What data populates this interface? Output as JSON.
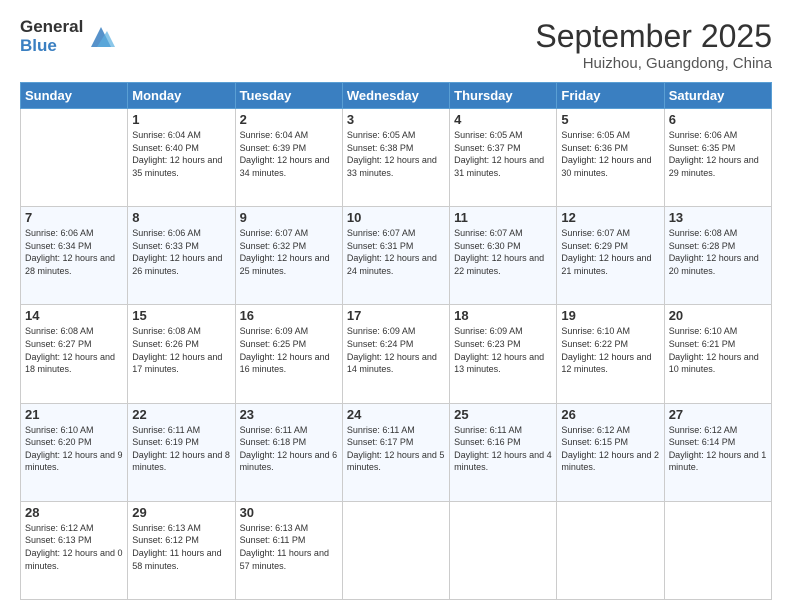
{
  "logo": {
    "general": "General",
    "blue": "Blue"
  },
  "header": {
    "month": "September 2025",
    "location": "Huizhou, Guangdong, China"
  },
  "weekdays": [
    "Sunday",
    "Monday",
    "Tuesday",
    "Wednesday",
    "Thursday",
    "Friday",
    "Saturday"
  ],
  "weeks": [
    [
      {
        "day": "",
        "sunrise": "",
        "sunset": "",
        "daylight": ""
      },
      {
        "day": "1",
        "sunrise": "Sunrise: 6:04 AM",
        "sunset": "Sunset: 6:40 PM",
        "daylight": "Daylight: 12 hours and 35 minutes."
      },
      {
        "day": "2",
        "sunrise": "Sunrise: 6:04 AM",
        "sunset": "Sunset: 6:39 PM",
        "daylight": "Daylight: 12 hours and 34 minutes."
      },
      {
        "day": "3",
        "sunrise": "Sunrise: 6:05 AM",
        "sunset": "Sunset: 6:38 PM",
        "daylight": "Daylight: 12 hours and 33 minutes."
      },
      {
        "day": "4",
        "sunrise": "Sunrise: 6:05 AM",
        "sunset": "Sunset: 6:37 PM",
        "daylight": "Daylight: 12 hours and 31 minutes."
      },
      {
        "day": "5",
        "sunrise": "Sunrise: 6:05 AM",
        "sunset": "Sunset: 6:36 PM",
        "daylight": "Daylight: 12 hours and 30 minutes."
      },
      {
        "day": "6",
        "sunrise": "Sunrise: 6:06 AM",
        "sunset": "Sunset: 6:35 PM",
        "daylight": "Daylight: 12 hours and 29 minutes."
      }
    ],
    [
      {
        "day": "7",
        "sunrise": "Sunrise: 6:06 AM",
        "sunset": "Sunset: 6:34 PM",
        "daylight": "Daylight: 12 hours and 28 minutes."
      },
      {
        "day": "8",
        "sunrise": "Sunrise: 6:06 AM",
        "sunset": "Sunset: 6:33 PM",
        "daylight": "Daylight: 12 hours and 26 minutes."
      },
      {
        "day": "9",
        "sunrise": "Sunrise: 6:07 AM",
        "sunset": "Sunset: 6:32 PM",
        "daylight": "Daylight: 12 hours and 25 minutes."
      },
      {
        "day": "10",
        "sunrise": "Sunrise: 6:07 AM",
        "sunset": "Sunset: 6:31 PM",
        "daylight": "Daylight: 12 hours and 24 minutes."
      },
      {
        "day": "11",
        "sunrise": "Sunrise: 6:07 AM",
        "sunset": "Sunset: 6:30 PM",
        "daylight": "Daylight: 12 hours and 22 minutes."
      },
      {
        "day": "12",
        "sunrise": "Sunrise: 6:07 AM",
        "sunset": "Sunset: 6:29 PM",
        "daylight": "Daylight: 12 hours and 21 minutes."
      },
      {
        "day": "13",
        "sunrise": "Sunrise: 6:08 AM",
        "sunset": "Sunset: 6:28 PM",
        "daylight": "Daylight: 12 hours and 20 minutes."
      }
    ],
    [
      {
        "day": "14",
        "sunrise": "Sunrise: 6:08 AM",
        "sunset": "Sunset: 6:27 PM",
        "daylight": "Daylight: 12 hours and 18 minutes."
      },
      {
        "day": "15",
        "sunrise": "Sunrise: 6:08 AM",
        "sunset": "Sunset: 6:26 PM",
        "daylight": "Daylight: 12 hours and 17 minutes."
      },
      {
        "day": "16",
        "sunrise": "Sunrise: 6:09 AM",
        "sunset": "Sunset: 6:25 PM",
        "daylight": "Daylight: 12 hours and 16 minutes."
      },
      {
        "day": "17",
        "sunrise": "Sunrise: 6:09 AM",
        "sunset": "Sunset: 6:24 PM",
        "daylight": "Daylight: 12 hours and 14 minutes."
      },
      {
        "day": "18",
        "sunrise": "Sunrise: 6:09 AM",
        "sunset": "Sunset: 6:23 PM",
        "daylight": "Daylight: 12 hours and 13 minutes."
      },
      {
        "day": "19",
        "sunrise": "Sunrise: 6:10 AM",
        "sunset": "Sunset: 6:22 PM",
        "daylight": "Daylight: 12 hours and 12 minutes."
      },
      {
        "day": "20",
        "sunrise": "Sunrise: 6:10 AM",
        "sunset": "Sunset: 6:21 PM",
        "daylight": "Daylight: 12 hours and 10 minutes."
      }
    ],
    [
      {
        "day": "21",
        "sunrise": "Sunrise: 6:10 AM",
        "sunset": "Sunset: 6:20 PM",
        "daylight": "Daylight: 12 hours and 9 minutes."
      },
      {
        "day": "22",
        "sunrise": "Sunrise: 6:11 AM",
        "sunset": "Sunset: 6:19 PM",
        "daylight": "Daylight: 12 hours and 8 minutes."
      },
      {
        "day": "23",
        "sunrise": "Sunrise: 6:11 AM",
        "sunset": "Sunset: 6:18 PM",
        "daylight": "Daylight: 12 hours and 6 minutes."
      },
      {
        "day": "24",
        "sunrise": "Sunrise: 6:11 AM",
        "sunset": "Sunset: 6:17 PM",
        "daylight": "Daylight: 12 hours and 5 minutes."
      },
      {
        "day": "25",
        "sunrise": "Sunrise: 6:11 AM",
        "sunset": "Sunset: 6:16 PM",
        "daylight": "Daylight: 12 hours and 4 minutes."
      },
      {
        "day": "26",
        "sunrise": "Sunrise: 6:12 AM",
        "sunset": "Sunset: 6:15 PM",
        "daylight": "Daylight: 12 hours and 2 minutes."
      },
      {
        "day": "27",
        "sunrise": "Sunrise: 6:12 AM",
        "sunset": "Sunset: 6:14 PM",
        "daylight": "Daylight: 12 hours and 1 minute."
      }
    ],
    [
      {
        "day": "28",
        "sunrise": "Sunrise: 6:12 AM",
        "sunset": "Sunset: 6:13 PM",
        "daylight": "Daylight: 12 hours and 0 minutes."
      },
      {
        "day": "29",
        "sunrise": "Sunrise: 6:13 AM",
        "sunset": "Sunset: 6:12 PM",
        "daylight": "Daylight: 11 hours and 58 minutes."
      },
      {
        "day": "30",
        "sunrise": "Sunrise: 6:13 AM",
        "sunset": "Sunset: 6:11 PM",
        "daylight": "Daylight: 11 hours and 57 minutes."
      },
      {
        "day": "",
        "sunrise": "",
        "sunset": "",
        "daylight": ""
      },
      {
        "day": "",
        "sunrise": "",
        "sunset": "",
        "daylight": ""
      },
      {
        "day": "",
        "sunrise": "",
        "sunset": "",
        "daylight": ""
      },
      {
        "day": "",
        "sunrise": "",
        "sunset": "",
        "daylight": ""
      }
    ]
  ]
}
